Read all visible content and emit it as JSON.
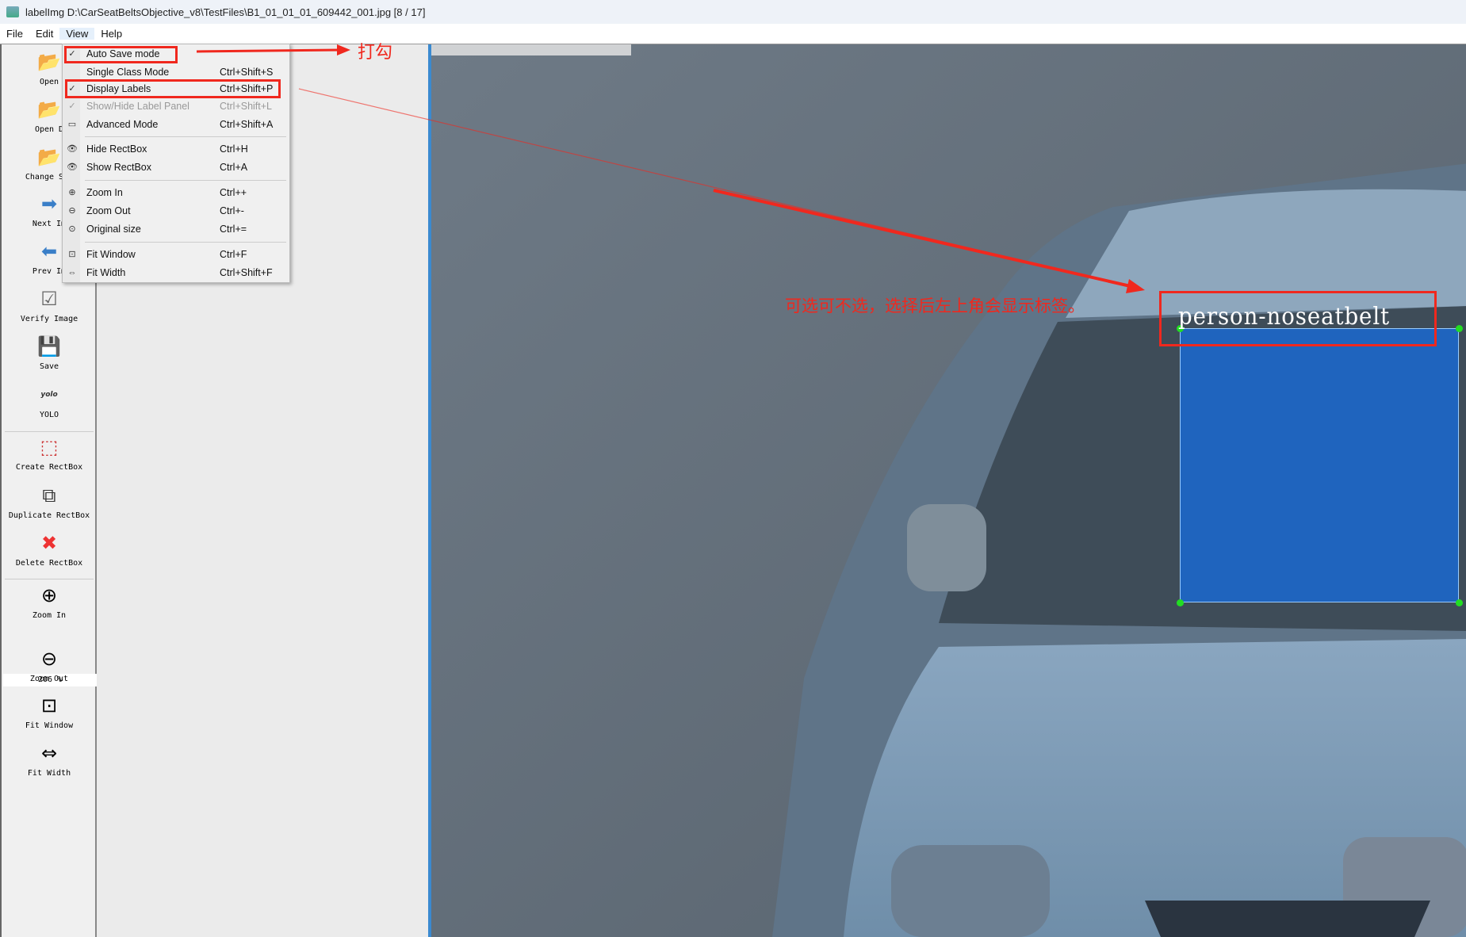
{
  "window": {
    "title": "labelImg D:\\CarSeatBeltsObjective_v8\\TestFiles\\B1_01_01_01_609442_001.jpg [8 / 17]"
  },
  "menubar": [
    "File",
    "Edit",
    "View",
    "Help"
  ],
  "view_menu": [
    {
      "label": "Auto Save mode",
      "shortcut": "",
      "check": "✓"
    },
    {
      "label": "Single Class Mode",
      "shortcut": "Ctrl+Shift+S",
      "check": ""
    },
    {
      "label": "Display Labels",
      "shortcut": "Ctrl+Shift+P",
      "check": "✓"
    },
    {
      "label": "Show/Hide Label Panel",
      "shortcut": "Ctrl+Shift+L",
      "check": "✓"
    },
    {
      "label": "Advanced Mode",
      "shortcut": "Ctrl+Shift+A",
      "check": "▭"
    },
    {
      "label": "Hide RectBox",
      "shortcut": "Ctrl+H",
      "check": "👁"
    },
    {
      "label": "Show RectBox",
      "shortcut": "Ctrl+A",
      "check": "👁"
    },
    {
      "label": "Zoom In",
      "shortcut": "Ctrl++",
      "check": "⊕"
    },
    {
      "label": "Zoom Out",
      "shortcut": "Ctrl+-",
      "check": "⊖"
    },
    {
      "label": "Original size",
      "shortcut": "Ctrl+=",
      "check": "⊙"
    },
    {
      "label": "Fit Window",
      "shortcut": "Ctrl+F",
      "check": "⊡"
    },
    {
      "label": "Fit Width",
      "shortcut": "Ctrl+Shift+F",
      "check": "⇔"
    }
  ],
  "toolbar": [
    {
      "label": "Open",
      "icon": "📂"
    },
    {
      "label": "Open D",
      "icon": "📂"
    },
    {
      "label": "Change Sav",
      "icon": "📂"
    },
    {
      "label": "Next Im",
      "icon": "➡"
    },
    {
      "label": "Prev Im",
      "icon": "⬅"
    },
    {
      "label": "Verify Image",
      "icon": "☑"
    },
    {
      "label": "Save",
      "icon": "💾"
    },
    {
      "label": "YOLO",
      "icon": "yolo"
    },
    {
      "label": "Create RectBox",
      "icon": "⬚"
    },
    {
      "label": "Duplicate RectBox",
      "icon": "⧉"
    },
    {
      "label": "Delete RectBox",
      "icon": "✖"
    },
    {
      "label": "Zoom In",
      "icon": "⊕"
    },
    {
      "label": "Zoom Out",
      "icon": "⊖"
    },
    {
      "label": "Fit Window",
      "icon": "⊡"
    },
    {
      "label": "Fit Width",
      "icon": "⇔"
    }
  ],
  "zoom_value": "206 %",
  "canvas": {
    "box_label": "person-noseatbelt"
  },
  "annotations": {
    "check_note": "打勾",
    "note": "可选可不选，选择后左上角会显示标签。"
  },
  "colors": {
    "annotation": "#f0281e",
    "box_fill": "#1e6ee6",
    "accent": "#3a8ad0"
  }
}
